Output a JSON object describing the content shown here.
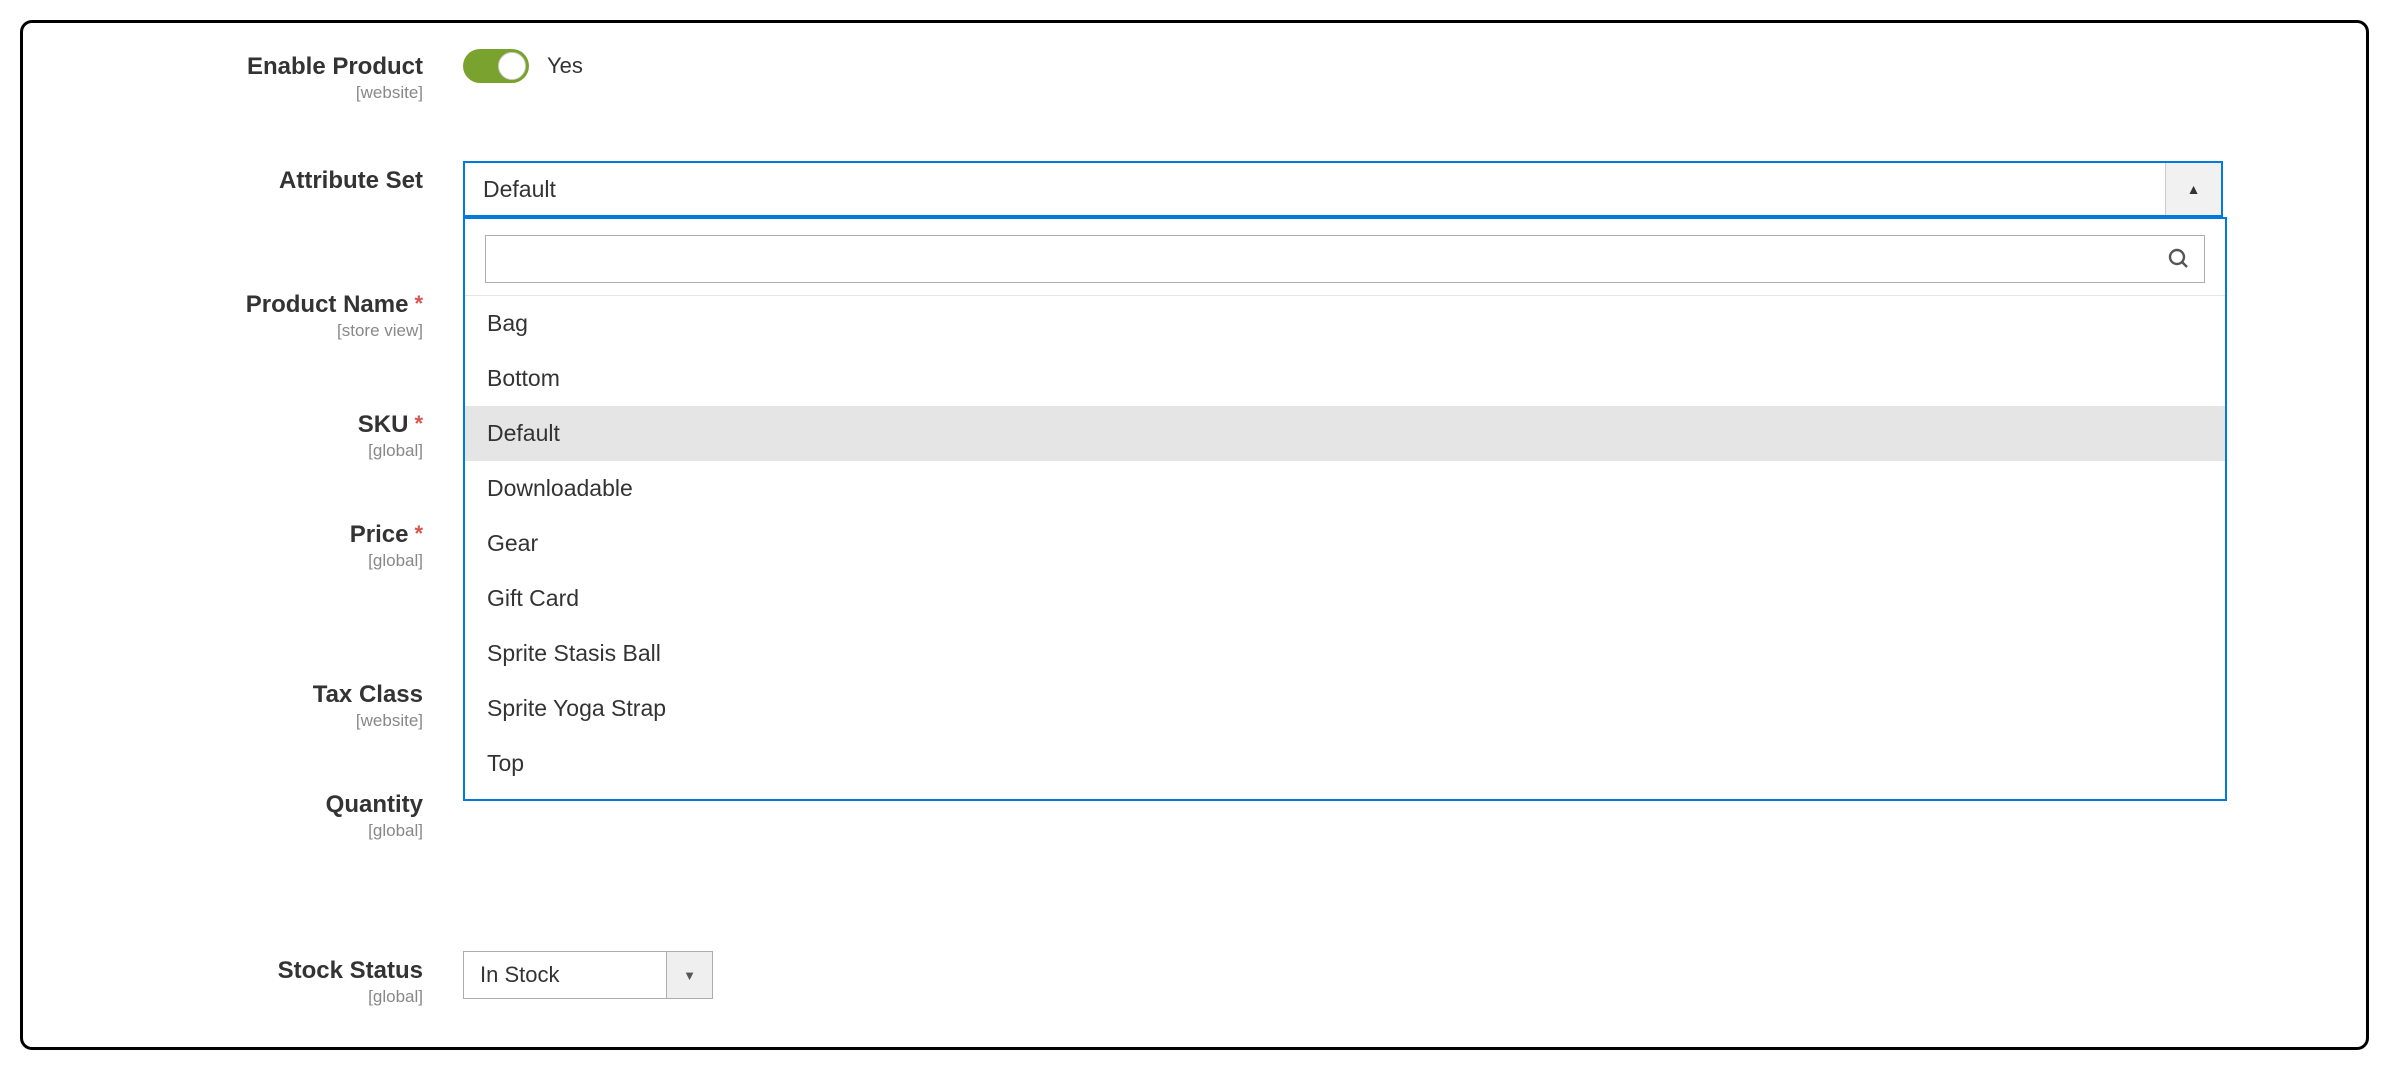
{
  "fields": {
    "enable_product": {
      "label": "Enable Product",
      "scope": "[website]",
      "value_text": "Yes"
    },
    "attribute_set": {
      "label": "Attribute Set",
      "selected": "Default",
      "options": [
        "Bag",
        "Bottom",
        "Default",
        "Downloadable",
        "Gear",
        "Gift Card",
        "Sprite Stasis Ball",
        "Sprite Yoga Strap",
        "Top"
      ],
      "search_value": ""
    },
    "product_name": {
      "label": "Product Name",
      "scope": "[store view]",
      "required": true
    },
    "sku": {
      "label": "SKU",
      "scope": "[global]",
      "required": true
    },
    "price": {
      "label": "Price",
      "scope": "[global]",
      "required": true
    },
    "tax_class": {
      "label": "Tax Class",
      "scope": "[website]"
    },
    "quantity": {
      "label": "Quantity",
      "scope": "[global]"
    },
    "stock_status": {
      "label": "Stock Status",
      "scope": "[global]",
      "selected": "In Stock"
    }
  },
  "required_mark": "*"
}
